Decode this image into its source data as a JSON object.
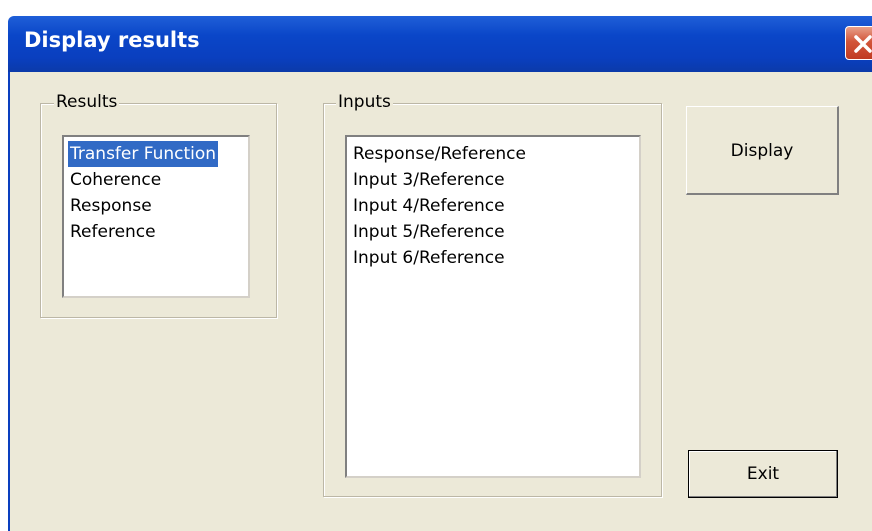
{
  "window": {
    "title": "Display results"
  },
  "results": {
    "label": "Results",
    "items": [
      "Transfer Function",
      "Coherence",
      "Response",
      "Reference"
    ],
    "selected": "Transfer Function"
  },
  "inputs": {
    "label": "Inputs",
    "items": [
      "Response/Reference",
      "Input 3/Reference",
      "Input 4/Reference",
      "Input 5/Reference",
      "Input 6/Reference"
    ]
  },
  "buttons": {
    "display": "Display",
    "exit": "Exit"
  },
  "colors": {
    "titlebar": "#0a3fbf",
    "selection": "#316ac5",
    "dialog_bg": "#ece9d8",
    "close": "#d2563a"
  }
}
